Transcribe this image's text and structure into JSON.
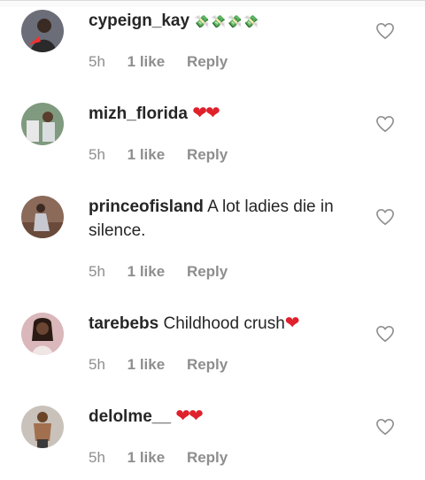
{
  "comments": [
    {
      "username": "cypeign_kay",
      "text": "",
      "emoji": "💸💸💸💸",
      "emoji_kind": "money",
      "time": "5h",
      "likes": "1 like",
      "reply": "Reply",
      "avatar_color": "#6b6e78"
    },
    {
      "username": "mizh_florida",
      "text": "",
      "emoji": "❤❤",
      "emoji_kind": "hearts",
      "time": "5h",
      "likes": "1 like",
      "reply": "Reply",
      "avatar_color": "#7f9a7e"
    },
    {
      "username": "princeofisland",
      "text": "A lot ladies die in silence.",
      "emoji": "",
      "emoji_kind": "",
      "time": "5h",
      "likes": "1 like",
      "reply": "Reply",
      "avatar_color": "#8b6a5a"
    },
    {
      "username": "tarebebs",
      "text": "Childhood crush",
      "emoji": "❤",
      "emoji_kind": "hearts",
      "time": "5h",
      "likes": "1 like",
      "reply": "Reply",
      "avatar_color": "#d9b7ba"
    },
    {
      "username": "delolme__",
      "text": "",
      "emoji": "❤❤",
      "emoji_kind": "hearts",
      "time": "5h",
      "likes": "1 like",
      "reply": "Reply",
      "avatar_color": "#c9c2bb"
    }
  ],
  "icons": {
    "like": "heart-outline-icon"
  }
}
